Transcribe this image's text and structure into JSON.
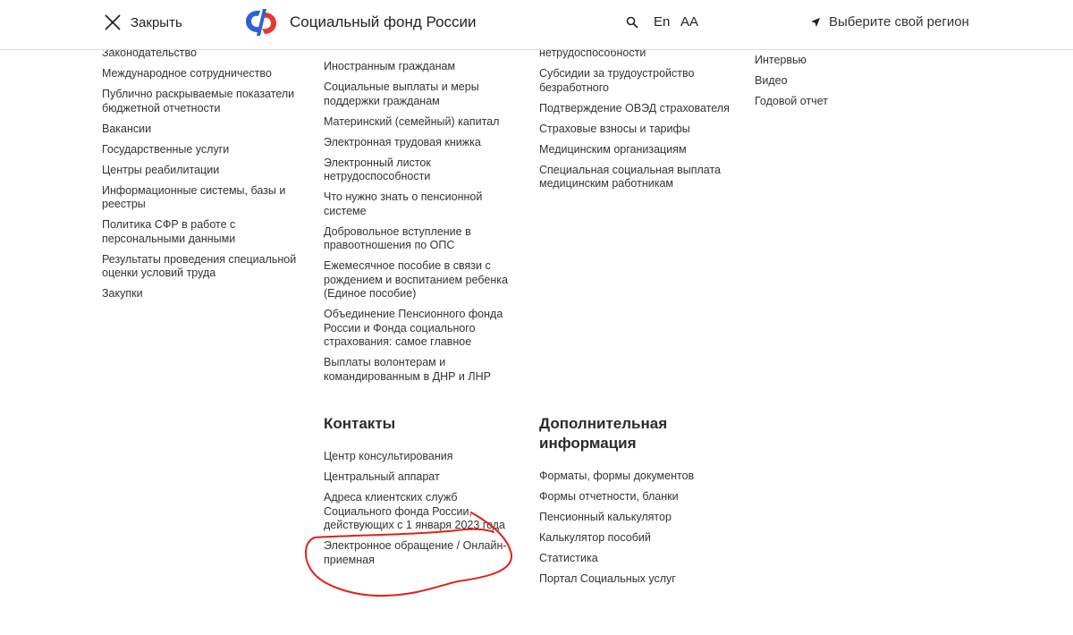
{
  "header": {
    "close_label": "Закрыть",
    "site_title": "Социальный фонд России",
    "lang_label": "En",
    "font_size_label": "AA",
    "region_label": "Выберите свой регион",
    "icons": {
      "close": "close-icon",
      "logo": "sfr-logo",
      "search": "search-icon",
      "region": "location-arrow-icon"
    },
    "colors": {
      "logo_blue": "#2a62d8",
      "logo_red": "#e7362f"
    }
  },
  "col1": {
    "links": [
      "Законодательство",
      "Международное сотрудничество",
      "Публично раскрываемые показатели бюджетной отчетности",
      "Вакансии",
      "Государственные услуги",
      "Центры реабилитации",
      "Информационные системы, базы и реестры",
      "Политика СФР в работе с персональными данными",
      "Результаты проведения специальной оценки условий труда",
      "Закупки"
    ]
  },
  "col2": {
    "links": [
      "Иностранным гражданам",
      "Социальные выплаты и меры поддержки гражданам",
      "Материнский (семейный) капитал",
      "Электронная трудовая книжка",
      "Электронный листок нетрудоспособности",
      "Что нужно знать о пенсионной системе",
      "Добровольное вступление в правоотношения по ОПС",
      "Ежемесячное пособие в связи с рождением и воспитанием ребенка (Единое пособие)",
      "Объединение Пенсионного фонда России и Фонда социального страхования: самое главное",
      "Выплаты волонтерам и командированным в ДНР и ЛНР"
    ]
  },
  "col3": {
    "links": [
      "нетрудоспособности",
      "Субсидии за трудоустройство безработного",
      "Подтверждение ОВЭД страхователя",
      "Страховые взносы и тарифы",
      "Медицинским организациям",
      "Специальная социальная выплата медицинским работникам"
    ]
  },
  "col4": {
    "links": [
      "Интервью",
      "Видео",
      "Годовой отчет"
    ]
  },
  "contacts": {
    "heading": "Контакты",
    "links": [
      "Центр консультирования",
      "Центральный аппарат",
      "Адреса клиентских служб Социального фонда России, действующих с 1 января 2023 года",
      "Электронное обращение / Онлайн-приемная"
    ]
  },
  "extra": {
    "heading": "Дополнительная информация",
    "links": [
      "Форматы, формы документов",
      "Формы отчетности, бланки",
      "Пенсионный калькулятор",
      "Калькулятор пособий",
      "Статистика",
      "Портал Социальных услуг"
    ]
  },
  "annotation": {
    "color": "#e0201b",
    "target": "Электронное обращение / Онлайн-приемная"
  }
}
